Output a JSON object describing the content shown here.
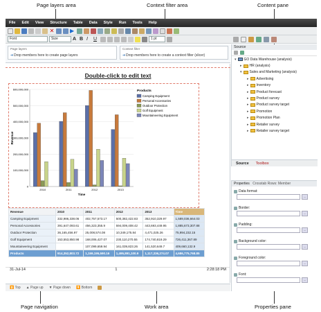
{
  "callouts": {
    "page_layers": "Page layers area",
    "context_filter": "Context filter area",
    "content_pane": "Content pane",
    "page_navigation": "Page navigation",
    "work_area": "Work area",
    "properties_pane": "Properties pane"
  },
  "menu": [
    "File",
    "Edit",
    "View",
    "Structure",
    "Table",
    "Data",
    "Style",
    "Run",
    "Tools",
    "Help"
  ],
  "toolbar2": {
    "font": "Font",
    "size": "Size",
    "line_width": "1 pt"
  },
  "page_layers": {
    "title": "Page layers",
    "hint": "Drop members here to create page layers"
  },
  "context_filter": {
    "title": "Context filter",
    "hint": "Drop members here to create a context filter (slicer)"
  },
  "report": {
    "title": "Double-click to edit text"
  },
  "chart_data": {
    "type": "bar",
    "categories": [
      "2010",
      "2011",
      "2012",
      "2013"
    ],
    "ylabel": "Revenue",
    "xlabel": "Time",
    "ylim": [
      0,
      600000000
    ],
    "yticks": [
      "600,000,000",
      "500,000,000",
      "400,000,000",
      "300,000,000",
      "200,000,000",
      "100,000,000",
      "0"
    ],
    "legend_title": "Products",
    "series": [
      {
        "name": "Camping Equipment",
        "color": "#5b6fa8",
        "values": [
          332986338,
          402757574,
          500382422,
          352910329
        ]
      },
      {
        "name": "Personal Accessories",
        "color": "#c77a3c",
        "values": [
          391647094,
          456323355,
          594009408,
          443693449
        ]
      },
      {
        "name": "Outdoor Protection",
        "color": "#8b9a56",
        "values": [
          36165457,
          25008574,
          10349175,
          4471025
        ]
      },
      {
        "name": "Golf Equipment",
        "color": "#c8d48a",
        "values": [
          153553850,
          168006427,
          230110270,
          174740819
        ]
      },
      {
        "name": "Mountaineering Equipment",
        "color": "#7c86b8",
        "values": [
          0,
          107099659,
          161039823,
          141520649
        ]
      }
    ]
  },
  "crosstab": {
    "header": [
      "Revenue",
      "2010",
      "2011",
      "2012",
      "2013",
      "Time"
    ],
    "rows": [
      [
        "Camping Equipment",
        "332,986,338.06",
        "402,757,573.17",
        "500,382,422.83",
        "352,910,329.97",
        "1,589,036,664.03"
      ],
      [
        "Personal Accessories",
        "391,647,093.61",
        "456,323,355.9",
        "594,009,408.42",
        "443,693,449.95",
        "1,885,673,307.88"
      ],
      [
        "Outdoor Protection",
        "36,165,456.97",
        "25,008,574.08",
        "10,349,175.84",
        "4,471,025.26",
        "75,994,232.15"
      ],
      [
        "Golf Equipment",
        "153,553,850.98",
        "168,006,427.07",
        "230,110,270.55",
        "174,740,819.29",
        "726,411,367.89"
      ],
      [
        "Mountaineering Equipment",
        "",
        "107,099,659.94",
        "161,039,823.26",
        "141,520,649.7",
        "409,660,132.9"
      ]
    ],
    "total": [
      "Products",
      "914,352,803.72",
      "1,159,195,590.16",
      "1,495,891,100.9",
      "1,117,336,274.07",
      "4,686,775,768.85"
    ]
  },
  "footer": {
    "date": "31-Jul-14",
    "page": "1",
    "time": "2:28:18 PM"
  },
  "pagenav": {
    "top": "Top",
    "page_up": "Page up",
    "page_down": "Page down",
    "bottom": "Bottom"
  },
  "source": {
    "title": "Source",
    "tree": [
      "GO Data Warehouse (analysis)",
      "HR (analysis)",
      "Sales and Marketing (analysis)",
      "Advertising",
      "Inventory",
      "Product forecast",
      "Product survey",
      "Product survey target",
      "Promotion",
      "Promotion Plan",
      "Retailer survey",
      "Retailer survey target"
    ],
    "tabs": [
      "Source",
      "Toolbox"
    ]
  },
  "properties": {
    "title": "Properties",
    "subtitle": "Crosstab Rows: Member",
    "fields": [
      "Data format:",
      "Border:",
      "Padding:",
      "Background color:",
      "Foreground color:",
      "Font:"
    ]
  }
}
